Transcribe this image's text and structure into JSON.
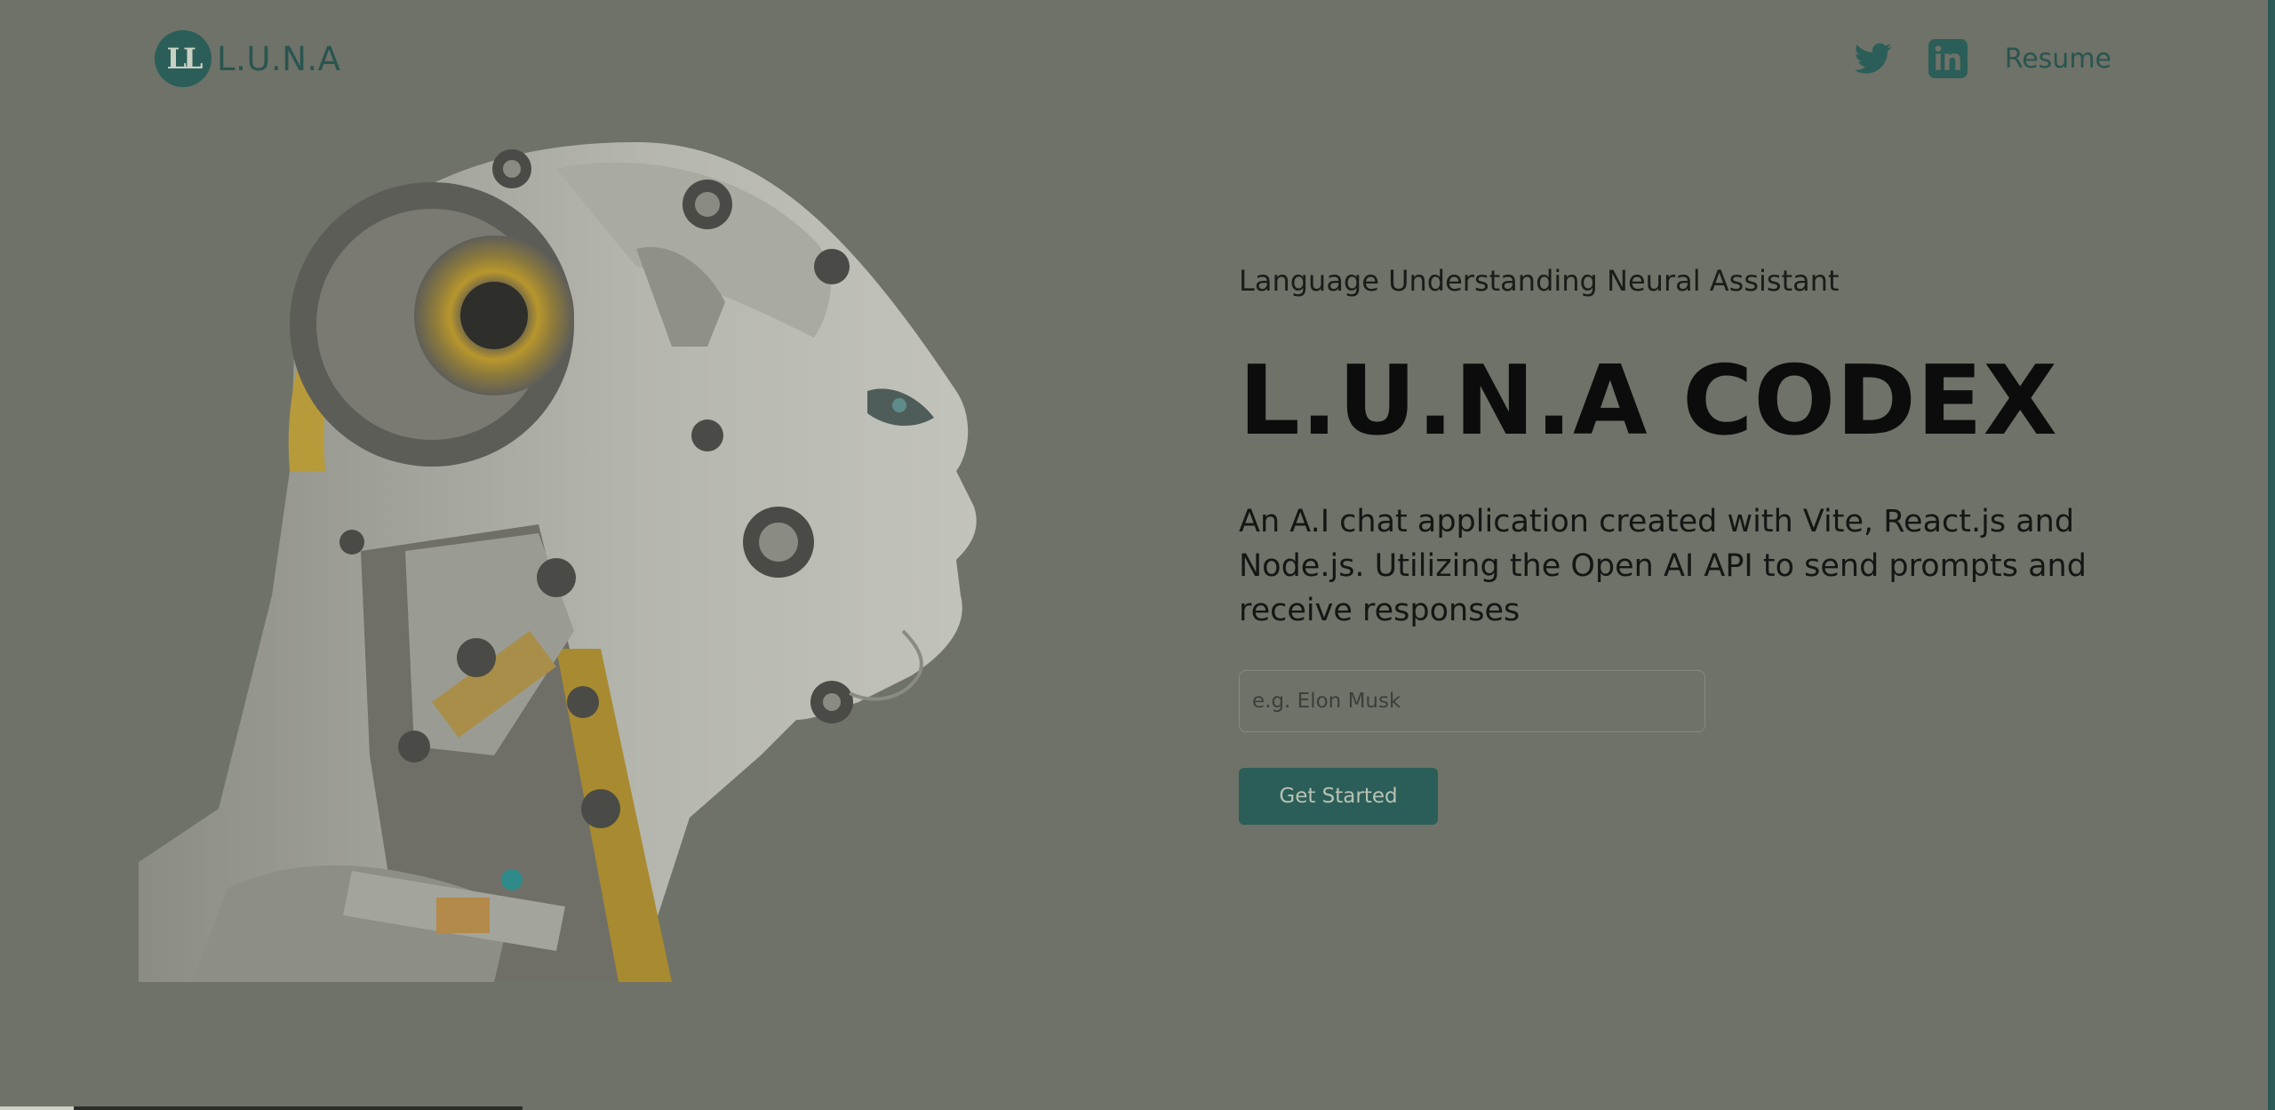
{
  "brand": {
    "badge_glyph": "LL",
    "name": "L.U.N.A"
  },
  "nav": {
    "twitter_icon": "twitter-icon",
    "linkedin_icon": "linkedin-icon",
    "resume_label": "Resume"
  },
  "hero": {
    "image": "robot-head-profile-illustration",
    "subtitle": "Language Understanding Neural Assistant",
    "title": "L.U.N.A CODEX",
    "description": "An A.I chat application created with Vite, React.js and Node.js. Utilizing the Open AI API to send prompts and receive responses",
    "input_placeholder": "e.g. Elon Musk",
    "input_value": "",
    "cta_label": "Get Started"
  },
  "colors": {
    "background": "#6e7268",
    "accent": "#2b5e58",
    "heading": "#0b0c0b"
  }
}
